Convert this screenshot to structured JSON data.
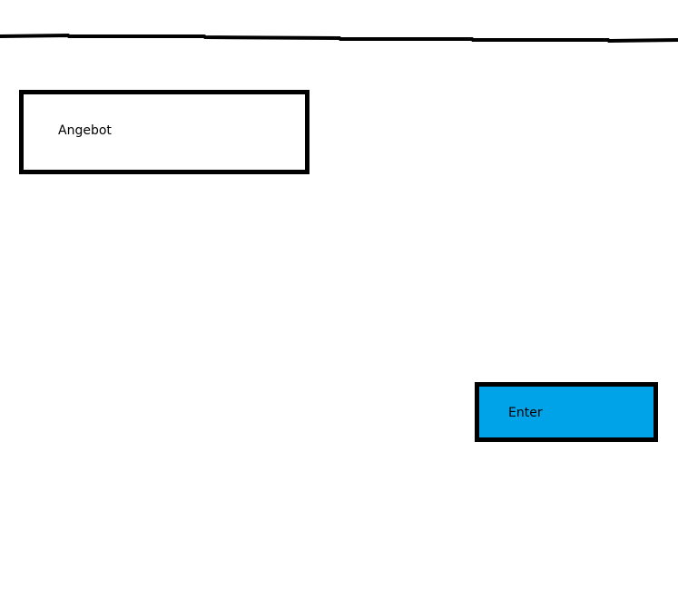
{
  "offer_field": {
    "label": "Angebot"
  },
  "enter_button": {
    "label": "Enter",
    "color": "#00a2e8"
  }
}
